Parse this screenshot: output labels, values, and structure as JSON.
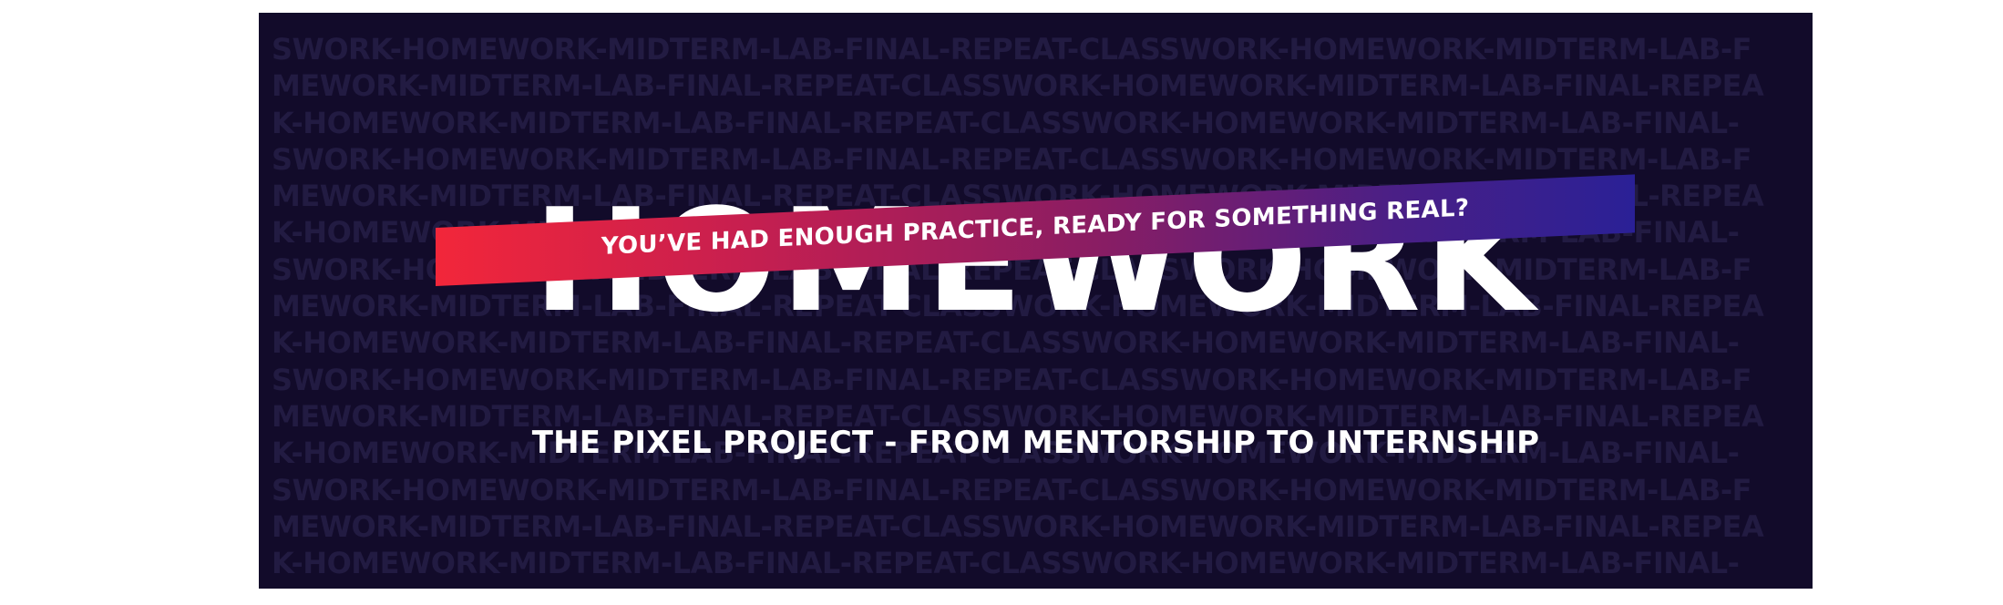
{
  "banner": {
    "background_color": "#120b2a",
    "pattern_lines": [
      "SWORK-HOMEWORK-MIDTERM-LAB-FINAL-REPEAT-CLASSWORK-HOMEWORK-MIDTERM-LAB-F",
      "MEWORK-MIDTERM-LAB-FINAL-REPEAT-CLASSWORK-HOMEWORK-MIDTERM-LAB-FINAL-REPEA",
      "K-HOMEWORK-MIDTERM-LAB-FINAL-REPEAT-CLASSWORK-HOMEWORK-MIDTERM-LAB-FINAL-",
      "SWORK-HOMEWORK-MIDTERM-LAB-FINAL-REPEAT-CLASSWORK-HOMEWORK-MIDTERM-LAB-F",
      "MEWORK-MIDTERM-LAB-FINAL-REPEAT-CLASSWORK-HOMEWORK-MIDTERM-LAB-FINAL-REPEA",
      "K-HOMEWORK-MIDTERM-LAB-FINAL-REPEAT-CLASSWORK-HOMEWORK-MIDTERM-LAB-FINAL-",
      "SWORK-HOMEWORK-MIDTERM-LAB-FINAL-REPEAT-CLASSWORK-HOMEWORK-MIDTERM-LAB-F",
      "MEWORK-MIDTERM-LAB-FINAL-REPEAT-CLASSWORK-HOMEWORK-MIDTERM-LAB-FINAL-REPEA",
      "K-HOMEWORK-MIDTERM-LAB-FINAL-REPEAT-CLASSWORK-HOMEWORK-MIDTERM-LAB-FINAL-",
      "SWORK-HOMEWORK-MIDTERM-LAB-FINAL-REPEAT-CLASSWORK-HOMEWORK-MIDTERM-LAB-F",
      "MEWORK-MIDTERM-LAB-FINAL-REPEAT-CLASSWORK-HOMEWORK-MIDTERM-LAB-FINAL-REPEA",
      "K-HOMEWORK-MIDTERM-LAB-FINAL-REPEAT-CLASSWORK-HOMEWORK-MIDTERM-LAB-FINAL-",
      "SWORK-HOMEWORK-MIDTERM-LAB-FINAL-REPEAT-CLASSWORK-HOMEWORK-MIDTERM-LAB-F",
      "MEWORK-MIDTERM-LAB-FINAL-REPEAT-CLASSWORK-HOMEWORK-MIDTERM-LAB-FINAL-REPEA",
      "K-HOMEWORK-MIDTERM-LAB-FINAL-REPEAT-CLASSWORK-HOMEWORK-MIDTERM-LAB-FINAL-"
    ],
    "headline": "HOMEWORK",
    "ribbon": {
      "text": "YOU’VE HAD ENOUGH PRACTICE, READY FOR SOMETHING REAL?",
      "gradient_start": "#f2263a",
      "gradient_end": "#2a2096"
    },
    "subtitle": "THE PIXEL PROJECT - FROM MENTORSHIP TO INTERNSHIP"
  }
}
